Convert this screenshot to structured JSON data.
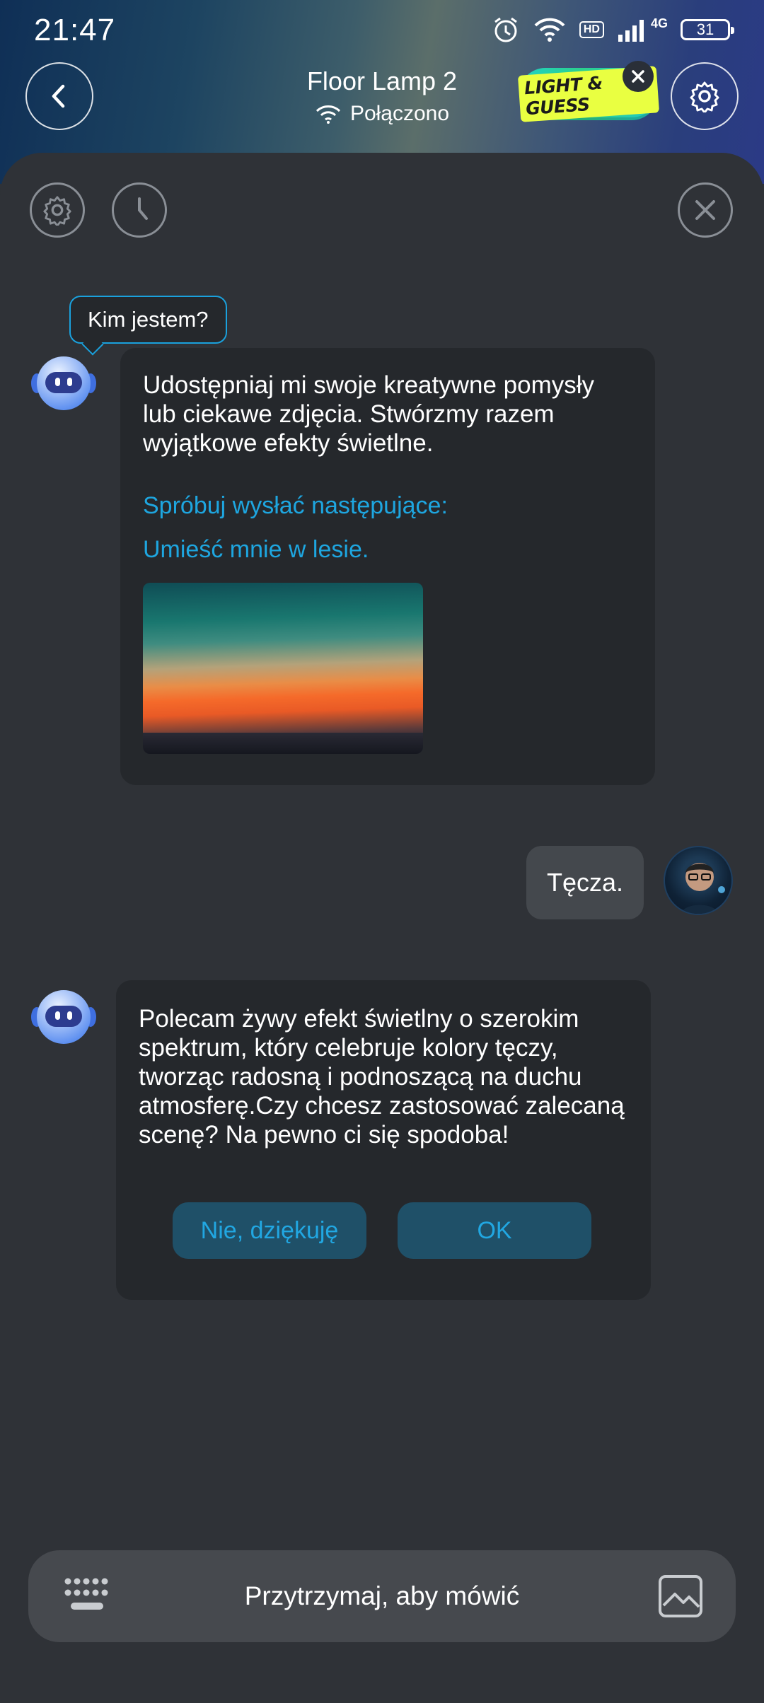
{
  "status": {
    "time": "21:47",
    "battery": "31",
    "network": "4G",
    "hd": "HD"
  },
  "header": {
    "title": "Floor Lamp 2",
    "connection": "Połączono",
    "game_badge": "LIGHT & GUESS"
  },
  "tooltip": "Kim jestem?",
  "bot_intro": {
    "text": "Udostępniaj mi swoje kreatywne pomysły lub ciekawe zdjęcia. Stwórzmy razem wyjątkowe efekty świetlne.",
    "try_label": "Spróbuj wysłać następujące:",
    "suggestion": "Umieść mnie w lesie."
  },
  "user_message": "Tęcza.",
  "bot_reply": {
    "text": "Polecam żywy efekt świetlny o szerokim spektrum, który celebruje kolory tęczy, tworząc radosną i podnoszącą na duchu atmosferę.Czy chcesz zastosować zalecaną scenę? Na pewno ci się spodoba!",
    "decline_label": "Nie, dziękuję",
    "accept_label": "OK"
  },
  "input": {
    "hold_to_talk": "Przytrzymaj, aby mówić"
  },
  "colors": {
    "accent": "#1ea6e0",
    "panel": "#2f3237",
    "bubble": "#25282c",
    "button": "#1f5068"
  }
}
